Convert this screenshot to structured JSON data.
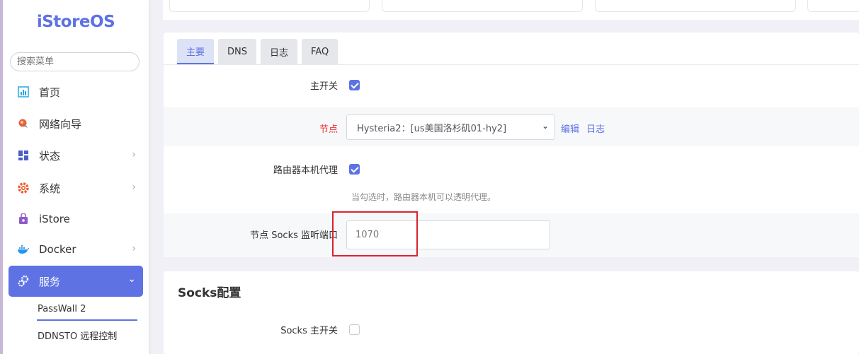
{
  "sidebar": {
    "logo": "iStoreOS",
    "search_placeholder": "搜索菜单",
    "items": [
      {
        "label": "首页",
        "icon": "dashboard-icon",
        "color": "#27a9e3"
      },
      {
        "label": "网络向导",
        "icon": "globe-pin-icon",
        "color": "#e8623c"
      },
      {
        "label": "状态",
        "icon": "grid-icon",
        "color": "#4a5fc9"
      },
      {
        "label": "系统",
        "icon": "gear-icon",
        "color": "#f05a2b"
      },
      {
        "label": "iStore",
        "icon": "store-bag-icon",
        "color": "#8e5cc9"
      },
      {
        "label": "Docker",
        "icon": "docker-whale-icon",
        "color": "#2496ed"
      },
      {
        "label": "服务",
        "icon": "services-gear-icon",
        "color": "#ffffff"
      }
    ],
    "sub_items": [
      "PassWall 2",
      "DDNSTO 远程控制"
    ]
  },
  "tabs": [
    "主要",
    "DNS",
    "日志",
    "FAQ"
  ],
  "form": {
    "main_switch_label": "主开关",
    "main_switch_checked": true,
    "node_label": "节点",
    "node_value": "Hysteria2：[us美国洛杉矶01-hy2]",
    "node_edit_link": "编辑",
    "node_log_link": "日志",
    "router_proxy_label": "路由器本机代理",
    "router_proxy_checked": true,
    "router_proxy_hint": "当勾选时，路由器本机可以透明代理。",
    "socks_port_label": "节点 Socks 监听端口",
    "socks_port_value": "1070"
  },
  "socks_section": {
    "title": "Socks配置",
    "switch_label": "Socks 主开关",
    "switch_checked": false
  },
  "colors": {
    "accent": "#5e72e4",
    "highlight_box": "#d9232d"
  }
}
